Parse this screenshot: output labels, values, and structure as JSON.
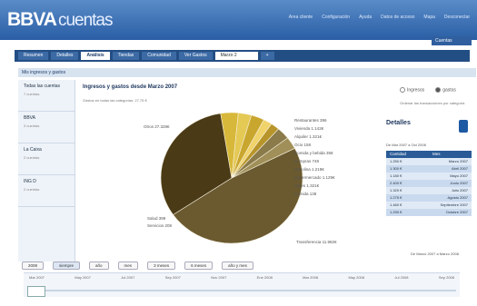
{
  "header": {
    "logo": "BBVA",
    "product": "cuentas",
    "links": [
      "Area cliente",
      "Configuración",
      "Ayuda",
      "Datos de acceso",
      "Mapa",
      "Desconectar"
    ],
    "user": "Cuentas"
  },
  "tabs": [
    "Resumen",
    "Detalles",
    "Análisis",
    "Tiendas",
    "Comunidad",
    "Ver Gastos",
    "Marzo 2",
    "+"
  ],
  "panel_title": "Mis ingresos y gastos",
  "sidebar": {
    "items": [
      {
        "name": "Todas las cuentas",
        "sub": "7 cuentas"
      },
      {
        "name": "BBVA",
        "sub": "3 cuentas"
      },
      {
        "name": "La Caixa",
        "sub": "2 cuentas"
      },
      {
        "name": "ING D",
        "sub": "2 cuentas"
      }
    ]
  },
  "chart": {
    "title": "Ingresos y gastos desde Marzo 2007",
    "subtitle": "Gastos en todas las categorías: 27.75 €",
    "slices": [
      {
        "label": "Otros 27.328€",
        "value": 48,
        "color": "#6b5a30"
      },
      {
        "label": "Transferencia 11.982€",
        "value": 32,
        "color": "#4a3a16"
      },
      {
        "label": "Restaurantes 396",
        "value": 4,
        "color": "#d8b83a"
      },
      {
        "label": "Compras 748",
        "value": 3,
        "color": "#e5c955"
      },
      {
        "label": "Supermercado 1.129€",
        "value": 3,
        "color": "#c9a62e"
      },
      {
        "label": "Alquiler 1.321€",
        "value": 2,
        "color": "#f0d36b"
      },
      {
        "label": "Comida 138",
        "value": 2,
        "color": "#b8952a"
      },
      {
        "label": "Salud 399",
        "value": 3,
        "color": "#8b7a4a"
      },
      {
        "label": "Servicios 208",
        "value": 3,
        "color": "#a08f58"
      }
    ],
    "side_labels": [
      "Vivienda 1.142€",
      "Ocio 158",
      "Comida y bebida 358",
      "Gasolina 1.218€",
      "Viajes 1.321€"
    ]
  },
  "options": {
    "radio_a": "Ingresos",
    "radio_b": "gastos",
    "sort_label": "Ordenar las transacciones por categoría"
  },
  "details": {
    "title": "Detalles",
    "period": "De Mar 2007 a Oct 2008",
    "col_a": "Cantidad",
    "col_b": "Mes",
    "rows": [
      {
        "amount": "1.250 €",
        "month": "Marzo 2007"
      },
      {
        "amount": "1.300 €",
        "month": "Abril 2007"
      },
      {
        "amount": "1.180 €",
        "month": "Mayo 2007"
      },
      {
        "amount": "2.400 €",
        "month": "Junio 2007"
      },
      {
        "amount": "1.320 €",
        "month": "Julio 2007"
      },
      {
        "amount": "1.275 €",
        "month": "Agosto 2007"
      },
      {
        "amount": "1.460 €",
        "month": "Septiembre 2007"
      },
      {
        "amount": "1.290 €",
        "month": "Octubre 2007"
      }
    ],
    "range_text": "De Marzo 2007 a Marzo 2008"
  },
  "time_buttons": [
    "2008",
    "siempre",
    "año",
    "mes",
    "3 meses",
    "6 meses",
    "año y mes"
  ],
  "timeline": [
    "Mar 2007",
    "May 2007",
    "Jul 2007",
    "Sep 2007",
    "Nov 2007",
    "Ene 2008",
    "Mar 2008",
    "May 2008",
    "Jul 2008",
    "Sep 2008"
  ]
}
